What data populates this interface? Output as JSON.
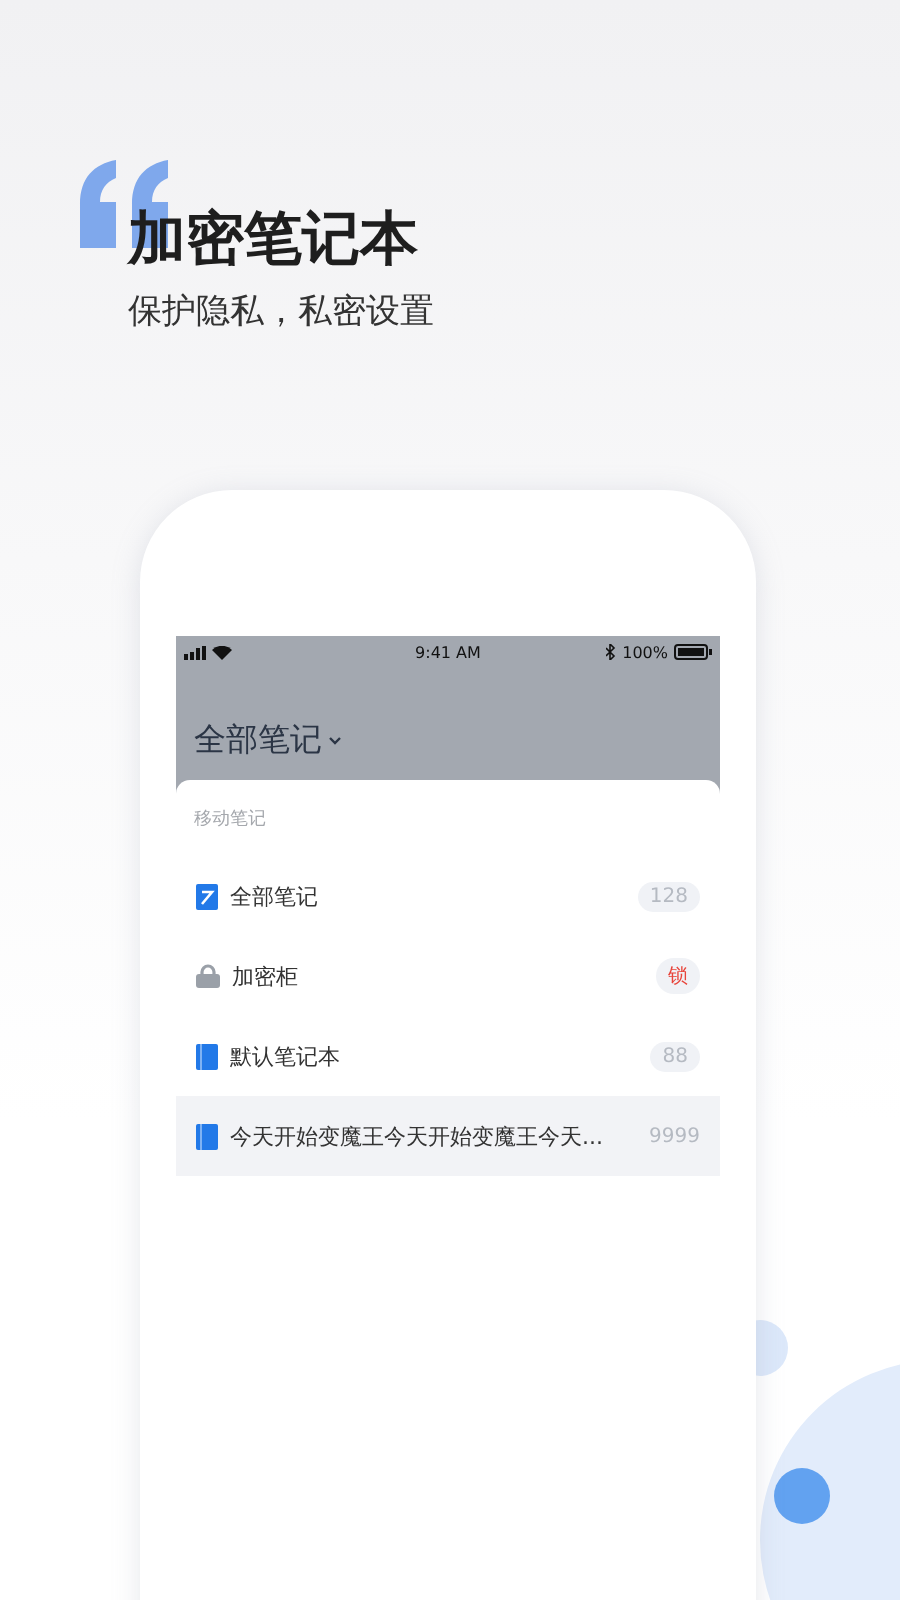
{
  "headline": {
    "title": "加密笔记本",
    "subtitle": "保护隐私，私密设置"
  },
  "status_bar": {
    "time": "9:41 AM",
    "battery": "100%"
  },
  "header": {
    "title": "全部笔记"
  },
  "section_label": "移动笔记",
  "items": [
    {
      "kind": "pen",
      "label": "全部笔记",
      "badge": {
        "text": "128",
        "kind": "count"
      },
      "selected": false
    },
    {
      "kind": "lock",
      "label": "加密柜",
      "badge": {
        "text": "锁",
        "kind": "alert"
      },
      "selected": false
    },
    {
      "kind": "book",
      "label": "默认笔记本",
      "badge": {
        "text": "88",
        "kind": "count"
      },
      "selected": false
    },
    {
      "kind": "book",
      "label": "今天开始变魔王今天开始变魔王今天...",
      "badge": {
        "text": "9999",
        "kind": "plain"
      },
      "selected": true
    }
  ]
}
